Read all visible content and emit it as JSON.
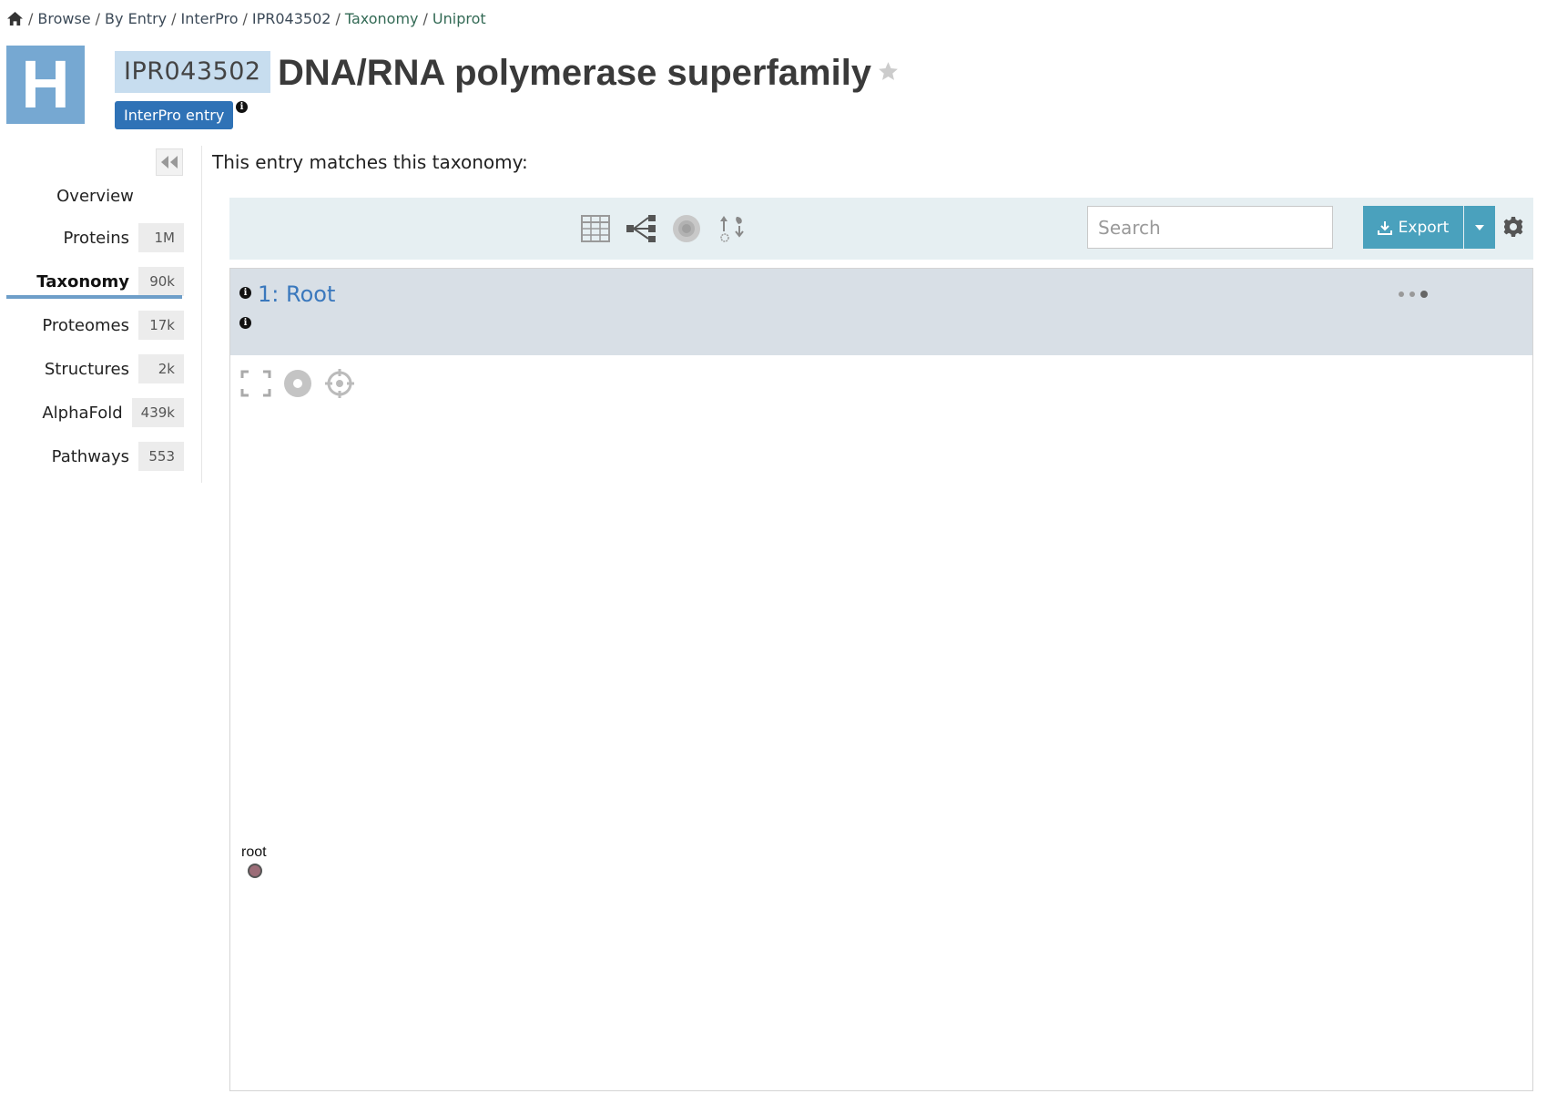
{
  "breadcrumb": {
    "items": [
      {
        "label": "Browse"
      },
      {
        "label": "By Entry"
      },
      {
        "label": "InterPro"
      },
      {
        "label": "IPR043502"
      },
      {
        "label": "Taxonomy"
      },
      {
        "label": "Uniprot"
      }
    ],
    "separator": "/"
  },
  "header": {
    "db_logo_letter": "H",
    "accession": "IPR043502",
    "title": "DNA/RNA polymerase superfamily",
    "entry_type_badge": "InterPro entry",
    "info_glyph": "i"
  },
  "sidebar": {
    "overview": "Overview",
    "items": [
      {
        "label": "Proteins",
        "count": "1M"
      },
      {
        "label": "Taxonomy",
        "count": "90k"
      },
      {
        "label": "Proteomes",
        "count": "17k"
      },
      {
        "label": "Structures",
        "count": "2k"
      },
      {
        "label": "AlphaFold",
        "count": "439k"
      },
      {
        "label": "Pathways",
        "count": "553"
      }
    ],
    "active": "Taxonomy"
  },
  "main": {
    "intro": "This entry matches this taxonomy:",
    "search_placeholder": "Search",
    "export_label": "Export",
    "node_title": "1: Root",
    "root_label": "root"
  },
  "colors": {
    "accent": "#2f72b6",
    "export": "#4aa1bd",
    "toolbar_bg": "#e6eff2",
    "tree_header_bg": "#d8dfe6",
    "logo_bg": "#76a8d2"
  }
}
